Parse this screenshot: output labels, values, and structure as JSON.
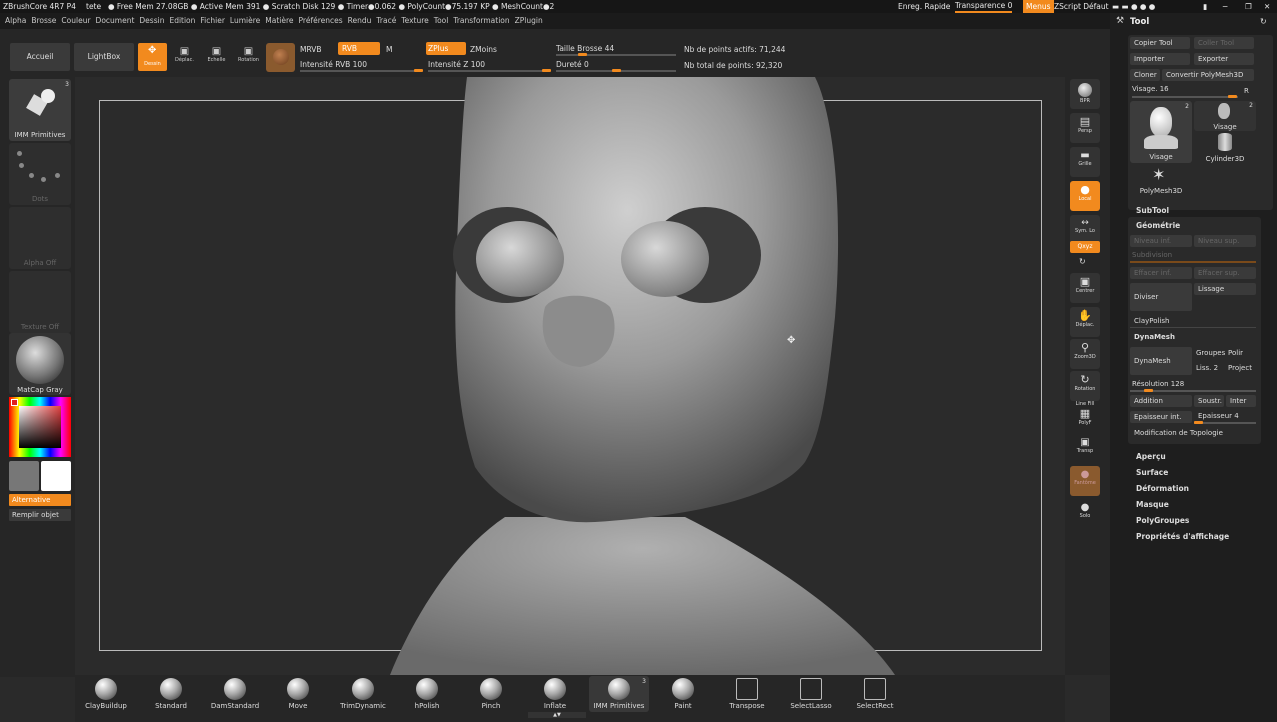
{
  "titlebar": {
    "app": "ZBrushCore 4R7 P4",
    "doc": "tete",
    "stats": "● Free Mem 27.08GB ● Active Mem 391 ● Scratch Disk 129 ● Timer●0.062 ● PolyCount●75.197 KP ● MeshCount●2",
    "quicksave": "Enreg. Rapide",
    "transparence": "Transparence 0",
    "menus": "Menus",
    "zscript": "ZScript Défaut"
  },
  "menu": [
    "Alpha",
    "Brosse",
    "Couleur",
    "Document",
    "Dessin",
    "Edition",
    "Fichier",
    "Lumière",
    "Matière",
    "Préférences",
    "Rendu",
    "Tracé",
    "Texture",
    "Tool",
    "Transformation",
    "ZPlugin"
  ],
  "toolbar": {
    "accueil": "Accueil",
    "lightbox": "LightBox",
    "dessin": "Dessin",
    "deplac": "Déplac.",
    "echelle": "Echelle",
    "rotation": "Rotation",
    "mrvb": "MRVB",
    "rvb": "RVB",
    "m": "M",
    "intensite_rvb": "Intensité RVB 100",
    "zplus": "ZPlus",
    "zmoins": "ZMoins",
    "intensite_z": "Intensité Z 100",
    "taille_brosse": "Taille Brosse 44",
    "durete": "Dureté 0",
    "points_actifs": "Nb de points actifs: 71,244",
    "points_total": "Nb total de points: 92,320",
    "rvb_intensity": 100,
    "z_intensity": 100,
    "brush_size": 44,
    "hardness": 0
  },
  "left": {
    "imm": "IMM Primitives",
    "imm_count": "3",
    "dots": "Dots",
    "alpha": "Alpha Off",
    "texture": "Texture Off",
    "matcap": "MatCap Gray",
    "alternative": "Alternative",
    "remplir": "Remplir objet"
  },
  "right_shelf": [
    "BPR",
    "Persp",
    "Grille",
    "Local",
    "Sym. Lo",
    "Qxyz",
    "Centrer",
    "Déplac.",
    "Zoom3D",
    "Rotation",
    "PolyF",
    "Transp",
    "Fantôme",
    "Solo"
  ],
  "right_shelf_linefill": "Line Fill",
  "tool": {
    "title": "Tool",
    "copier": "Copier Tool",
    "coller": "Coller Tool",
    "importer": "Importer",
    "exporter": "Exporter",
    "cloner": "Cloner",
    "convertir": "Convertir PolyMesh3D",
    "visage_slider": "Visage. 16",
    "r": "R",
    "thumbs": [
      {
        "label": "Visage",
        "count": "2"
      },
      {
        "label": "Visage",
        "count": "2"
      },
      {
        "label": "Cylinder3D",
        "count": ""
      },
      {
        "label": "PolyMesh3D",
        "count": ""
      }
    ],
    "subtool": "SubTool",
    "geometrie": "Géométrie",
    "niveau_inf": "Niveau inf.",
    "niveau_sup": "Niveau sup.",
    "subdivision": "Subdivision",
    "effacer_inf": "Effacer inf.",
    "effacer_sup": "Effacer sup.",
    "diviser": "Diviser",
    "lissage": "Lissage",
    "claypolish": "ClayPolish",
    "dynamesh_head": "DynaMesh",
    "dynamesh": "DynaMesh",
    "groupes": "Groupes",
    "polir": "Polir",
    "liss": "Liss. 2",
    "project": "Project",
    "resolution": "Résolution 128",
    "addition": "Addition",
    "soustr": "Soustr.",
    "inter": "Inter",
    "epaisseur_int": "Epaisseur int.",
    "epaisseur": "Epaisseur 4",
    "modif_topo": "Modification de Topologie",
    "sections": [
      "Aperçu",
      "Surface",
      "Déformation",
      "Masque",
      "PolyGroupes",
      "Propriétés d'affichage"
    ]
  },
  "brushes": [
    "ClayBuildup",
    "Standard",
    "DamStandard",
    "Move",
    "TrimDynamic",
    "hPolish",
    "Pinch",
    "Inflate",
    "IMM Primitives",
    "Paint",
    "Transpose",
    "SelectLasso",
    "SelectRect"
  ],
  "brush_imm_count": "3",
  "colors": {
    "accent": "#f28a1e",
    "bg": "#2a2a2a"
  }
}
